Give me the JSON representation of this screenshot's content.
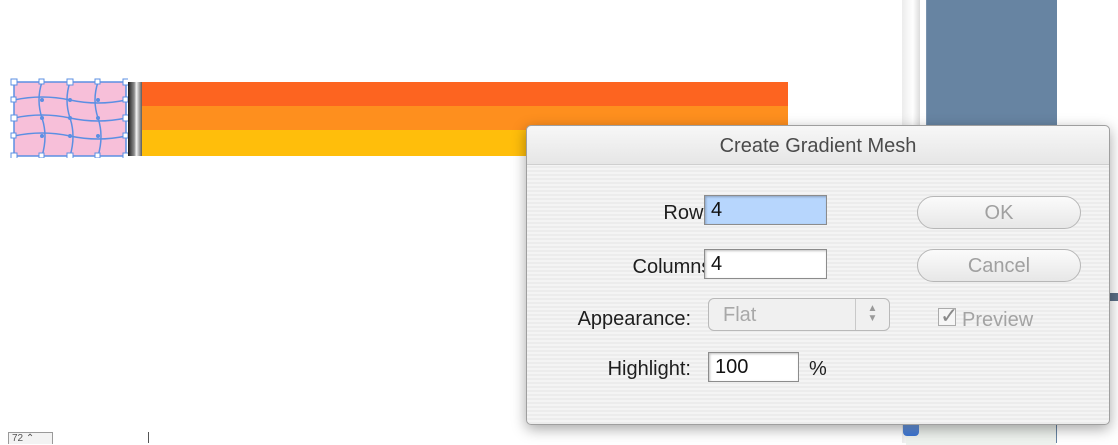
{
  "dialog": {
    "title": "Create Gradient Mesh",
    "rows": {
      "label": "Rows:",
      "value": "4"
    },
    "columns": {
      "label": "Columns:",
      "value": "4"
    },
    "appearance": {
      "label": "Appearance:",
      "selected": "Flat"
    },
    "highlight": {
      "label": "Highlight:",
      "value": "100",
      "unit": "%"
    },
    "ok_label": "OK",
    "cancel_label": "Cancel",
    "preview": {
      "label": "Preview",
      "checked": true
    }
  },
  "artwork": {
    "stripe_colors": [
      "#fd6420",
      "#fe8f1e",
      "#ffbe0b"
    ],
    "mesh_fill": "#f7bfd9",
    "mesh_lines": "#5b8fe3"
  },
  "status_bar": {
    "zoom_text": "72  ⌃"
  },
  "icons": {
    "select_arrows": "updown-arrows-icon",
    "preview_check": "checkmark-icon"
  }
}
